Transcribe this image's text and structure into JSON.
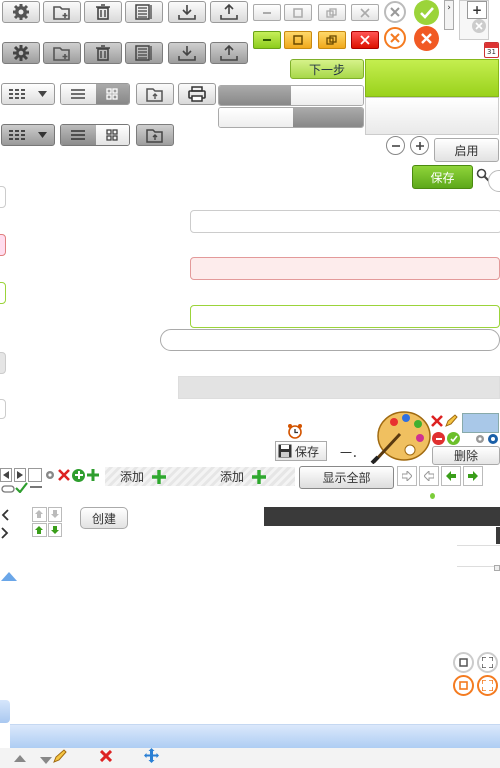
{
  "toolbar": {
    "next_label": "下一步",
    "enable_label": "启用",
    "save_label": "保存",
    "save2_label": "保存",
    "delete_label": "删除",
    "add_label": "添加",
    "add2_label": "添加",
    "show_all_label": "显示全部",
    "create_label": "创建",
    "separator_text": "一．"
  },
  "calendar": {
    "day": "31"
  },
  "colors": {
    "accent_green": "#8cc63f",
    "danger_red": "#e8452c",
    "orange": "#f47b20",
    "blue_panel": "#a9c8e8",
    "dark_bar": "#3a3a3a"
  },
  "icons": [
    "gear-icon",
    "folder-add-icon",
    "trash-icon",
    "list-view-icon",
    "download-icon",
    "upload-icon",
    "minimize-icon",
    "maximize-icon",
    "restore-icon",
    "close-icon",
    "check-icon",
    "cancel-icon",
    "search-icon",
    "print-icon",
    "alarm-clock-icon",
    "palette-icon",
    "pencil-icon",
    "move-icon"
  ]
}
